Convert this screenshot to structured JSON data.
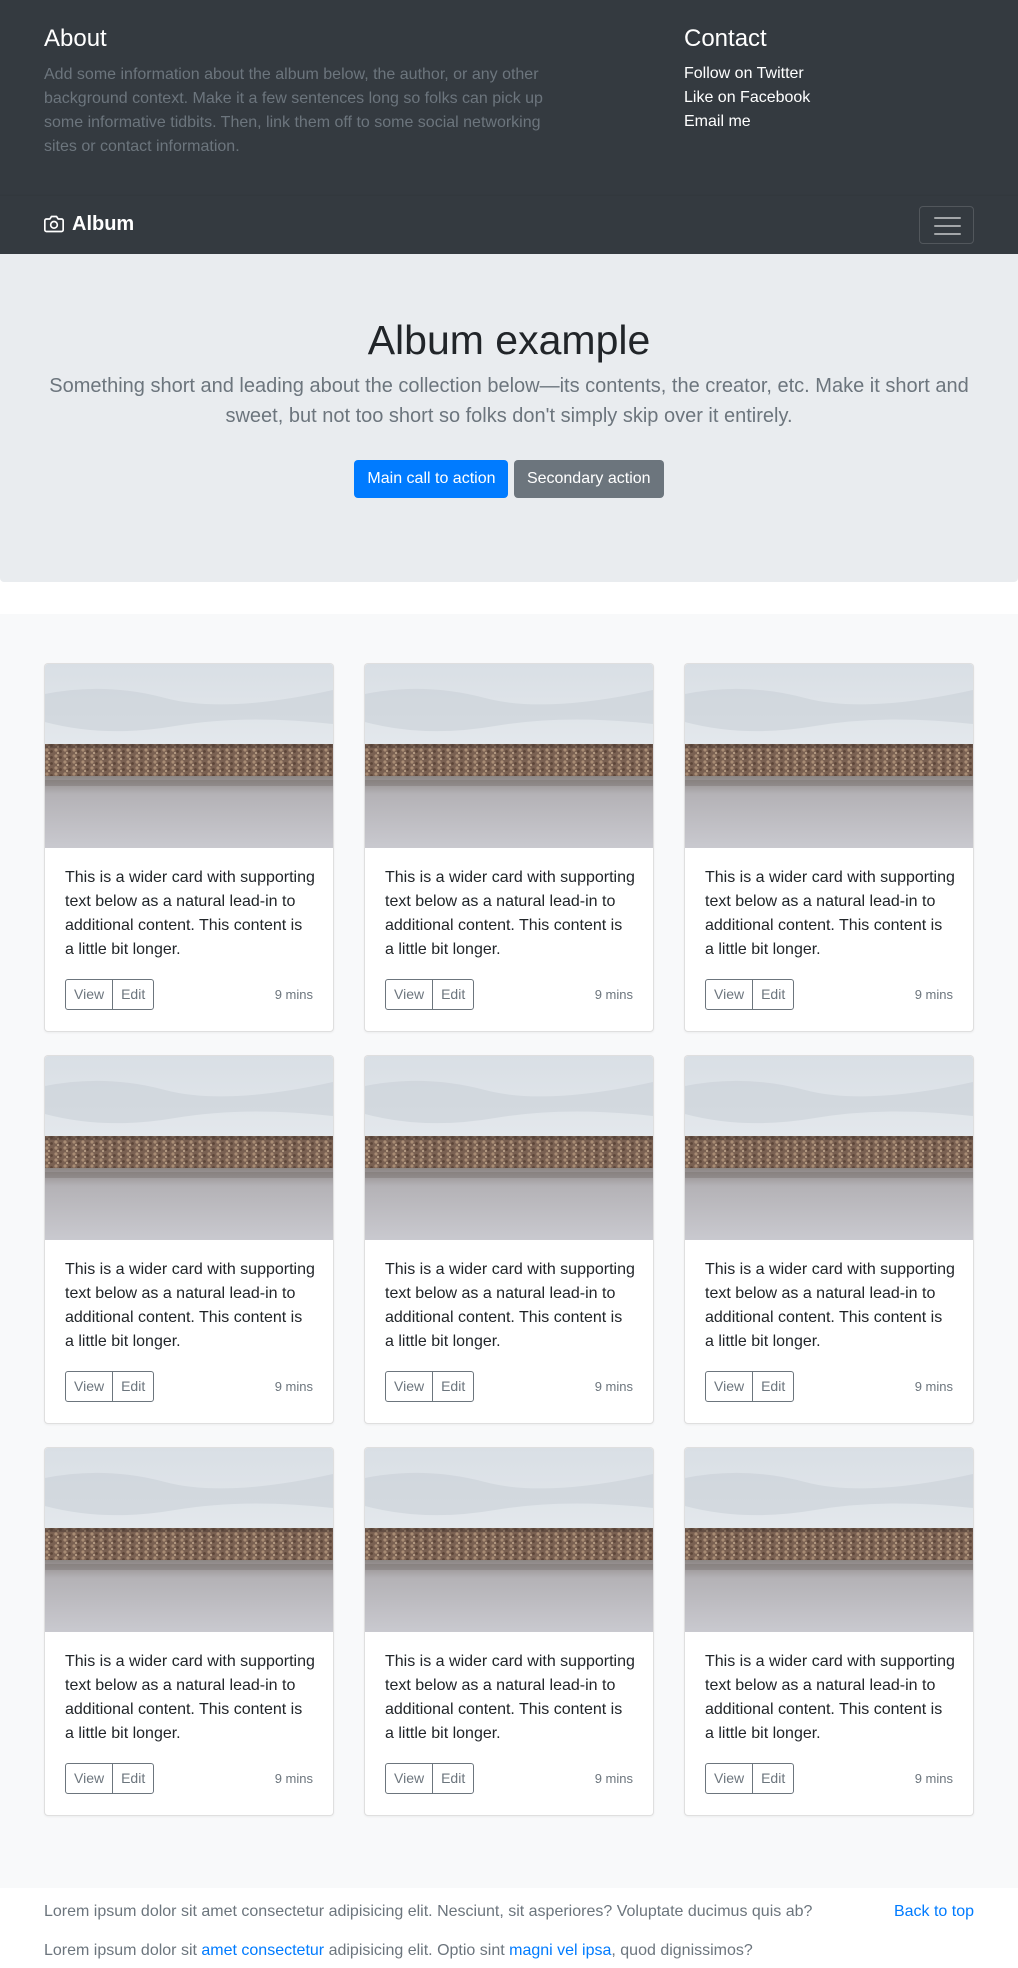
{
  "about": {
    "title": "About",
    "text": "Add some information about the album below, the author, or any other background context. Make it a few sentences long so folks can pick up some informative tidbits. Then, link them off to some social networking sites or contact information."
  },
  "contact": {
    "title": "Contact",
    "links": [
      "Follow on Twitter",
      "Like on Facebook",
      "Email me"
    ]
  },
  "navbar": {
    "brand_icon": "camera-icon",
    "brand": "Album",
    "toggler_icon": "hamburger-icon"
  },
  "jumbotron": {
    "heading": "Album example",
    "lead": "Something short and leading about the collection below—its contents, the creator, etc. Make it short and sweet, but not too short so folks don't simply skip over it entirely.",
    "primary_label": "Main call to action",
    "secondary_label": "Secondary action"
  },
  "cards": [
    {
      "text": "This is a wider card with supporting text below as a natural lead-in to additional content. This content is a little bit longer.",
      "view": "View",
      "edit": "Edit",
      "time": "9 mins"
    },
    {
      "text": "This is a wider card with supporting text below as a natural lead-in to additional content. This content is a little bit longer.",
      "view": "View",
      "edit": "Edit",
      "time": "9 mins"
    },
    {
      "text": "This is a wider card with supporting text below as a natural lead-in to additional content. This content is a little bit longer.",
      "view": "View",
      "edit": "Edit",
      "time": "9 mins"
    },
    {
      "text": "This is a wider card with supporting text below as a natural lead-in to additional content. This content is a little bit longer.",
      "view": "View",
      "edit": "Edit",
      "time": "9 mins"
    },
    {
      "text": "This is a wider card with supporting text below as a natural lead-in to additional content. This content is a little bit longer.",
      "view": "View",
      "edit": "Edit",
      "time": "9 mins"
    },
    {
      "text": "This is a wider card with supporting text below as a natural lead-in to additional content. This content is a little bit longer.",
      "view": "View",
      "edit": "Edit",
      "time": "9 mins"
    },
    {
      "text": "This is a wider card with supporting text below as a natural lead-in to additional content. This content is a little bit longer.",
      "view": "View",
      "edit": "Edit",
      "time": "9 mins"
    },
    {
      "text": "This is a wider card with supporting text below as a natural lead-in to additional content. This content is a little bit longer.",
      "view": "View",
      "edit": "Edit",
      "time": "9 mins"
    },
    {
      "text": "This is a wider card with supporting text below as a natural lead-in to additional content. This content is a little bit longer.",
      "view": "View",
      "edit": "Edit",
      "time": "9 mins"
    }
  ],
  "footer": {
    "line1": "Lorem ipsum dolor sit amet consectetur adipisicing elit. Nesciunt, sit asperiores? Voluptate ducimus quis ab?",
    "back_to_top": "Back to top",
    "line2_a": "Lorem ipsum dolor sit ",
    "link1": "amet consectetur",
    "line2_b": " adipisicing elit. Optio sint ",
    "link2": "magni vel ipsa",
    "line2_c": ", quod dignissimos?"
  },
  "colors": {
    "header_bg": "#343a40",
    "jumbotron_bg": "#e9ecef",
    "album_bg": "#f8f9fa",
    "primary": "#007bff",
    "secondary": "#6c757d"
  }
}
